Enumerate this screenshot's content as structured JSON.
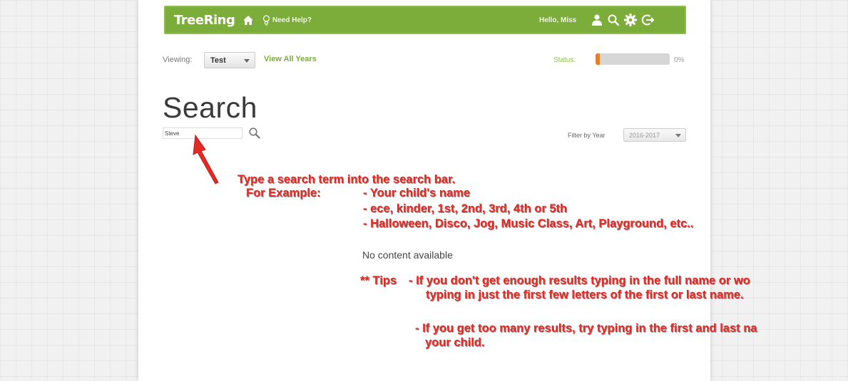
{
  "header": {
    "brand": "TreeRing",
    "help_label": "Need Help?",
    "greeting": "Hello, Miss",
    "icons": [
      "home-icon",
      "lightbulb-icon",
      "user-icon",
      "search-icon",
      "gear-icon",
      "logout-icon"
    ],
    "color": "#7cac3a"
  },
  "viewing": {
    "label": "Viewing:",
    "selected": "Test",
    "view_all": "View All Years"
  },
  "status": {
    "label": "Status:",
    "percent_text": "0%",
    "fill_fraction": 0.06,
    "fill_color": "#f07d1a"
  },
  "search": {
    "title": "Search",
    "query": "Steve",
    "filter_label": "Filter by Year",
    "filter_value": "2016-2017"
  },
  "results": {
    "empty_message": "No content available"
  },
  "annotations": {
    "line1": "Type a search term into the search bar.",
    "example_label": "For Example:",
    "example1": "- Your child's name",
    "example2": "- ece, kinder, 1st, 2nd, 3rd, 4th or 5th",
    "example3": "- Halloween, Disco, Jog, Music Class, Art, Playground, etc..",
    "tips_label": "** Tips",
    "tip1_line1": "- If you don't get enough results typing in the full name or wo",
    "tip1_line2": "typing in just the first few letters of the first or last name.",
    "tip2_line1": "- If you get too many results, try typing in the first and last na",
    "tip2_line2": "your child.",
    "color": "#e52a24"
  }
}
